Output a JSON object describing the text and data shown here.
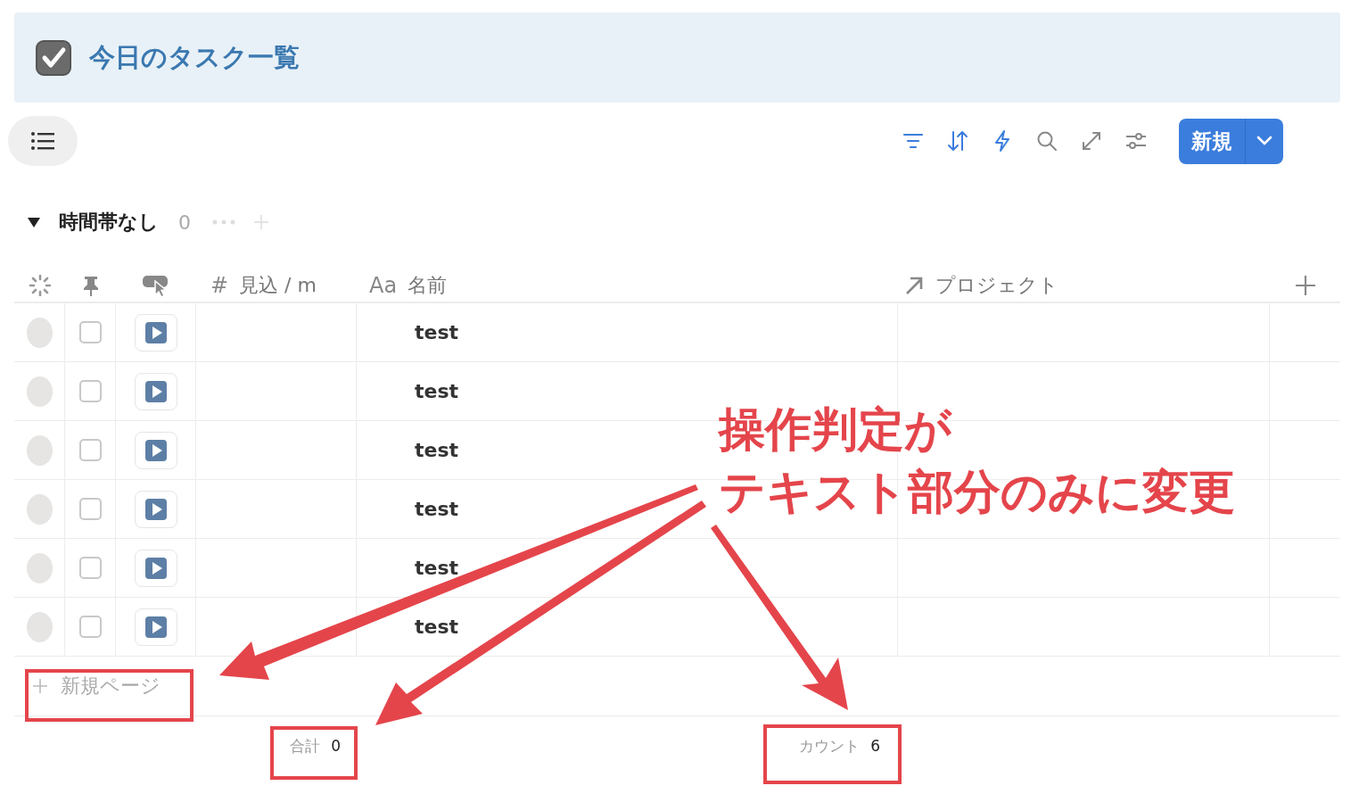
{
  "header": {
    "title": "今日のタスク一覧",
    "checked": true
  },
  "toolbar": {
    "new_button": "新規"
  },
  "group": {
    "label": "時間帯なし",
    "count": "0",
    "expanded": true
  },
  "table": {
    "columns": [
      {
        "glyph": "#",
        "label": "見込 / m"
      },
      {
        "glyph": "Aa",
        "label": "名前"
      },
      {
        "label": "プロジェクト"
      }
    ],
    "rows": [
      {
        "name": "test",
        "checked": false
      },
      {
        "name": "test",
        "checked": false
      },
      {
        "name": "test",
        "checked": false
      },
      {
        "name": "test",
        "checked": false
      },
      {
        "name": "test",
        "checked": false
      },
      {
        "name": "test",
        "checked": false
      }
    ],
    "new_row": "新規ページ",
    "footer": [
      {
        "label": "合計",
        "value": "0"
      },
      {
        "label": "カウント",
        "value": "6"
      }
    ]
  },
  "annotation": {
    "lines": [
      "操作判定が",
      "テキスト部分のみに変更"
    ]
  }
}
